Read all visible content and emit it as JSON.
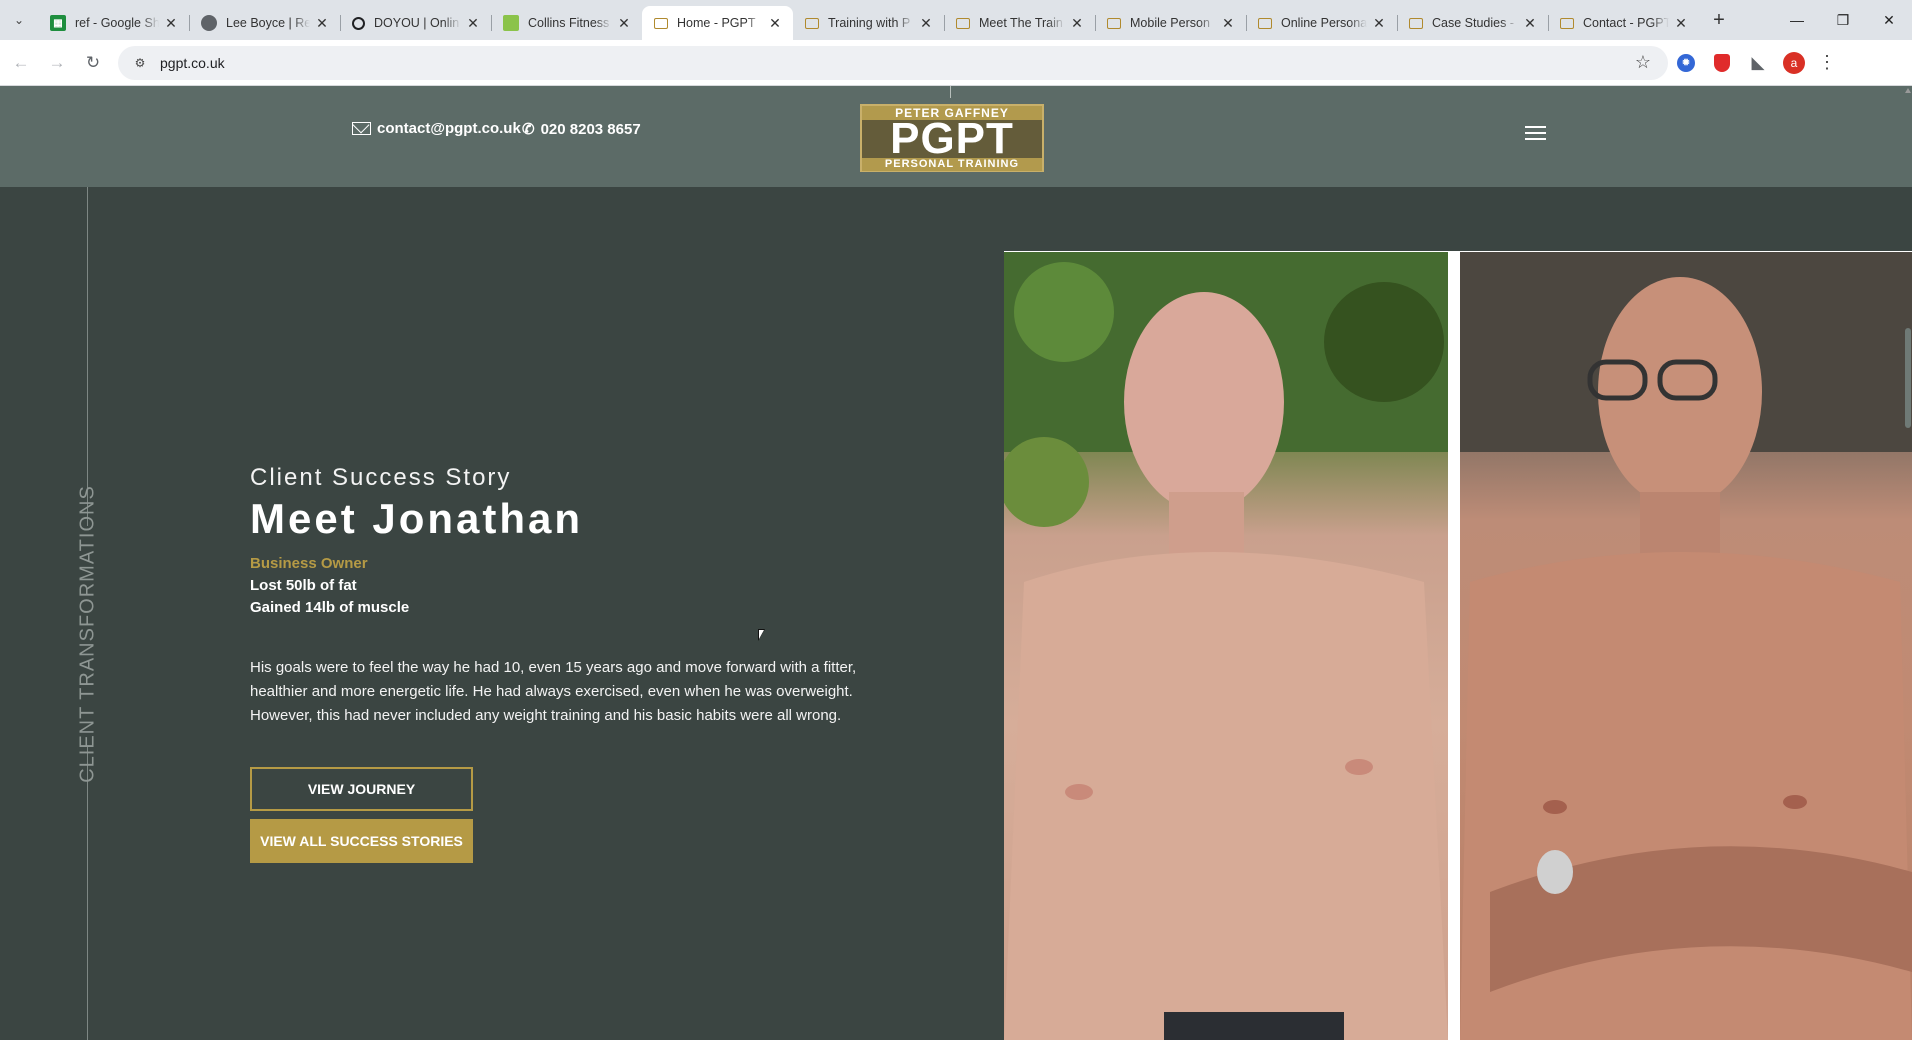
{
  "browser": {
    "tabs": [
      {
        "title": "ref - Google Sh",
        "favicon": "sheets-icon"
      },
      {
        "title": "Lee Boyce | Rea",
        "favicon": "person-icon"
      },
      {
        "title": "DOYOU | Onlin",
        "favicon": "circle-o-icon"
      },
      {
        "title": "Collins Fitness",
        "favicon": "green-square-icon"
      },
      {
        "title": "Home - PGPT",
        "favicon": "page-icon",
        "active": true
      },
      {
        "title": "Training with P",
        "favicon": "page-icon"
      },
      {
        "title": "Meet The Train",
        "favicon": "page-icon"
      },
      {
        "title": "Mobile Person",
        "favicon": "page-icon"
      },
      {
        "title": "Online Persona",
        "favicon": "page-icon"
      },
      {
        "title": "Case Studies -",
        "favicon": "page-icon"
      },
      {
        "title": "Contact - PGPT",
        "favicon": "page-icon"
      }
    ],
    "url": "pgpt.co.uk",
    "profile_initial": "a"
  },
  "header": {
    "email": "contact@pgpt.co.uk",
    "phone": "020 8203 8657",
    "logo": {
      "top": "PETER GAFFNEY",
      "main": "PGPT",
      "bottom": "PERSONAL TRAINING"
    }
  },
  "sidebar": {
    "label": "CLIENT TRANSFORMATIONS"
  },
  "story": {
    "kicker": "Client Success Story",
    "headline": "Meet Jonathan",
    "role": "Business Owner",
    "stat_1": "Lost 50lb of fat",
    "stat_2": "Gained 14lb of muscle",
    "description": "His goals were to feel the way he had 10, even 15 years ago and move forward with a fitter, healthier and more energetic life. He had always exercised, even when he was overweight. However, this had never included any weight training and his basic habits were all wrong.",
    "button_journey": "VIEW JOURNEY",
    "button_all": "VIEW ALL SUCCESS STORIES"
  },
  "colors": {
    "page_bg": "#3b4542",
    "header_bg": "#5c6b67",
    "accent_gold": "#b59a45"
  }
}
